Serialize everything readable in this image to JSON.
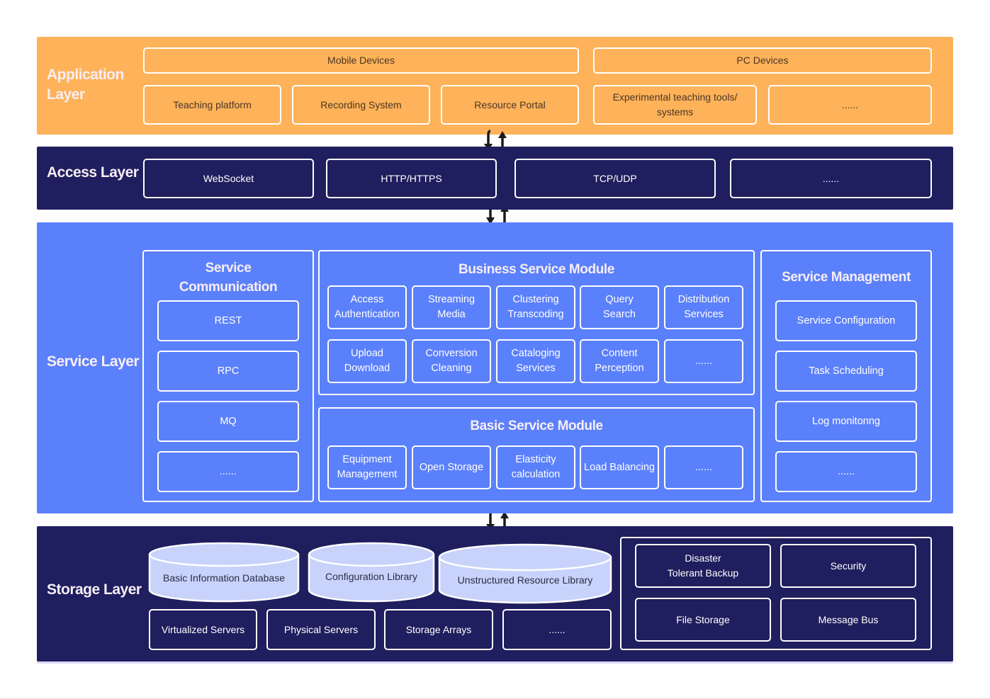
{
  "colors": {
    "application": "#feb259",
    "access": "#1f1e5e",
    "service": "#5b80fb",
    "storage": "#1f1e5e",
    "cylinder": "#c8d2fb",
    "border": "#ffffff",
    "arrow": "#1b1b1b"
  },
  "application_layer": {
    "title_line1": "Application",
    "title_line2": "Layer",
    "devices": [
      "Mobile Devices",
      "PC Devices"
    ],
    "systems": [
      "Teaching platform",
      "Recording System",
      "Resource Portal",
      "Experimental teaching tools/ systems",
      "......"
    ]
  },
  "arrows": {
    "icon": "bidirectional-arrows-icon"
  },
  "access_layer": {
    "title": "Access Layer",
    "protocols": [
      "WebSocket",
      "HTTP/HTTPS",
      "TCP/UDP",
      "......"
    ]
  },
  "service_layer": {
    "title": "Service Layer",
    "communication": {
      "title_line1": "Service",
      "title_line2": "Communication",
      "items": [
        "REST",
        "RPC",
        "MQ",
        "......"
      ]
    },
    "business": {
      "title": "Business Service Module",
      "row1": [
        [
          "Access",
          "Authentication"
        ],
        [
          "Streaming",
          "Media"
        ],
        [
          "Clustering",
          "Transcoding"
        ],
        [
          "Query",
          "Search"
        ],
        [
          "Distribution",
          "Services"
        ]
      ],
      "row2": [
        [
          "Upload",
          "Download"
        ],
        [
          "Conversion",
          "Cleaning"
        ],
        [
          "Cataloging",
          "Services"
        ],
        [
          "Content",
          "Perception"
        ],
        [
          "......",
          ""
        ]
      ]
    },
    "basic": {
      "title": "Basic Service Module",
      "items": [
        [
          "Equipment",
          "Management"
        ],
        [
          "Open Storage",
          ""
        ],
        [
          "Elasticity",
          "calculation"
        ],
        [
          "Load Balancing",
          ""
        ],
        [
          "......",
          ""
        ]
      ]
    },
    "management": {
      "title": "Service Management",
      "items": [
        "Service Configuration",
        "Task Scheduling",
        "Log monitonng",
        "......"
      ]
    }
  },
  "storage_layer": {
    "title": "Storage Layer",
    "databases": [
      "Basic Information Database",
      "Configuration Library",
      "Unstructured Resource Library"
    ],
    "servers": [
      "Virtualized Servers",
      "Physical Servers",
      "Storage Arrays",
      "......"
    ],
    "services": [
      [
        "Disaster",
        "Tolerant Backup"
      ],
      [
        "Security",
        ""
      ],
      [
        "File Storage",
        ""
      ],
      [
        "Message Bus",
        ""
      ]
    ]
  }
}
